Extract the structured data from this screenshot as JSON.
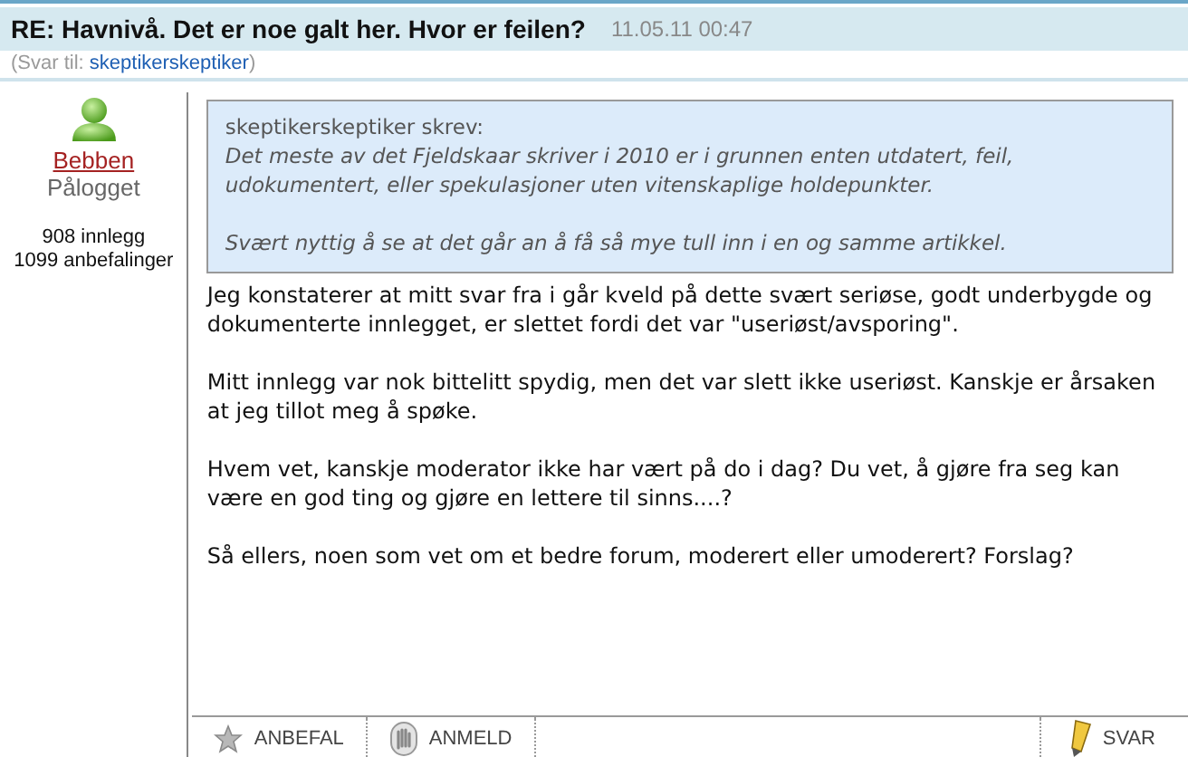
{
  "post": {
    "title": "RE: Havnivå. Det er noe galt her. Hvor er feilen?",
    "timestamp": "11.05.11 00:47",
    "reply_to_label": "(Svar til: ",
    "reply_to_user": "skeptikerskeptiker",
    "reply_to_close": ")"
  },
  "author": {
    "name": "Bebben",
    "status": "Pålogget",
    "posts": "908 innlegg",
    "recommendations": "1099 anbefalinger"
  },
  "quote": {
    "header": "skeptikerskeptiker skrev:",
    "paragraphs": [
      "Det meste av det Fjeldskaar skriver i 2010 er i grunnen enten utdatert, feil, udokumentert, eller spekulasjoner uten vitenskaplige holdepunkter.",
      "Svært nyttig å se at det går an å få så mye tull inn i en og samme artikkel."
    ]
  },
  "body": [
    "Jeg konstaterer at mitt svar fra i går kveld på dette svært seriøse, godt underbygde og dokumenterte innlegget, er slettet fordi det var \"useriøst/avsporing\".",
    "Mitt innlegg var nok bittelitt spydig, men det var slett ikke useriøst. Kanskje er årsaken at jeg tillot meg å spøke.",
    "Hvem vet, kanskje moderator ikke har vært på do i dag? Du vet, å gjøre fra seg kan være en god ting og gjøre en lettere til sinns....?",
    "Så ellers, noen som vet om et bedre forum, moderert eller umoderert? Forslag?"
  ],
  "actions": [
    {
      "kind": "star",
      "label": "ANBEFAL"
    },
    {
      "kind": "hand",
      "label": "ANMELD"
    },
    {
      "kind": "pencil",
      "label": "SVAR"
    }
  ]
}
